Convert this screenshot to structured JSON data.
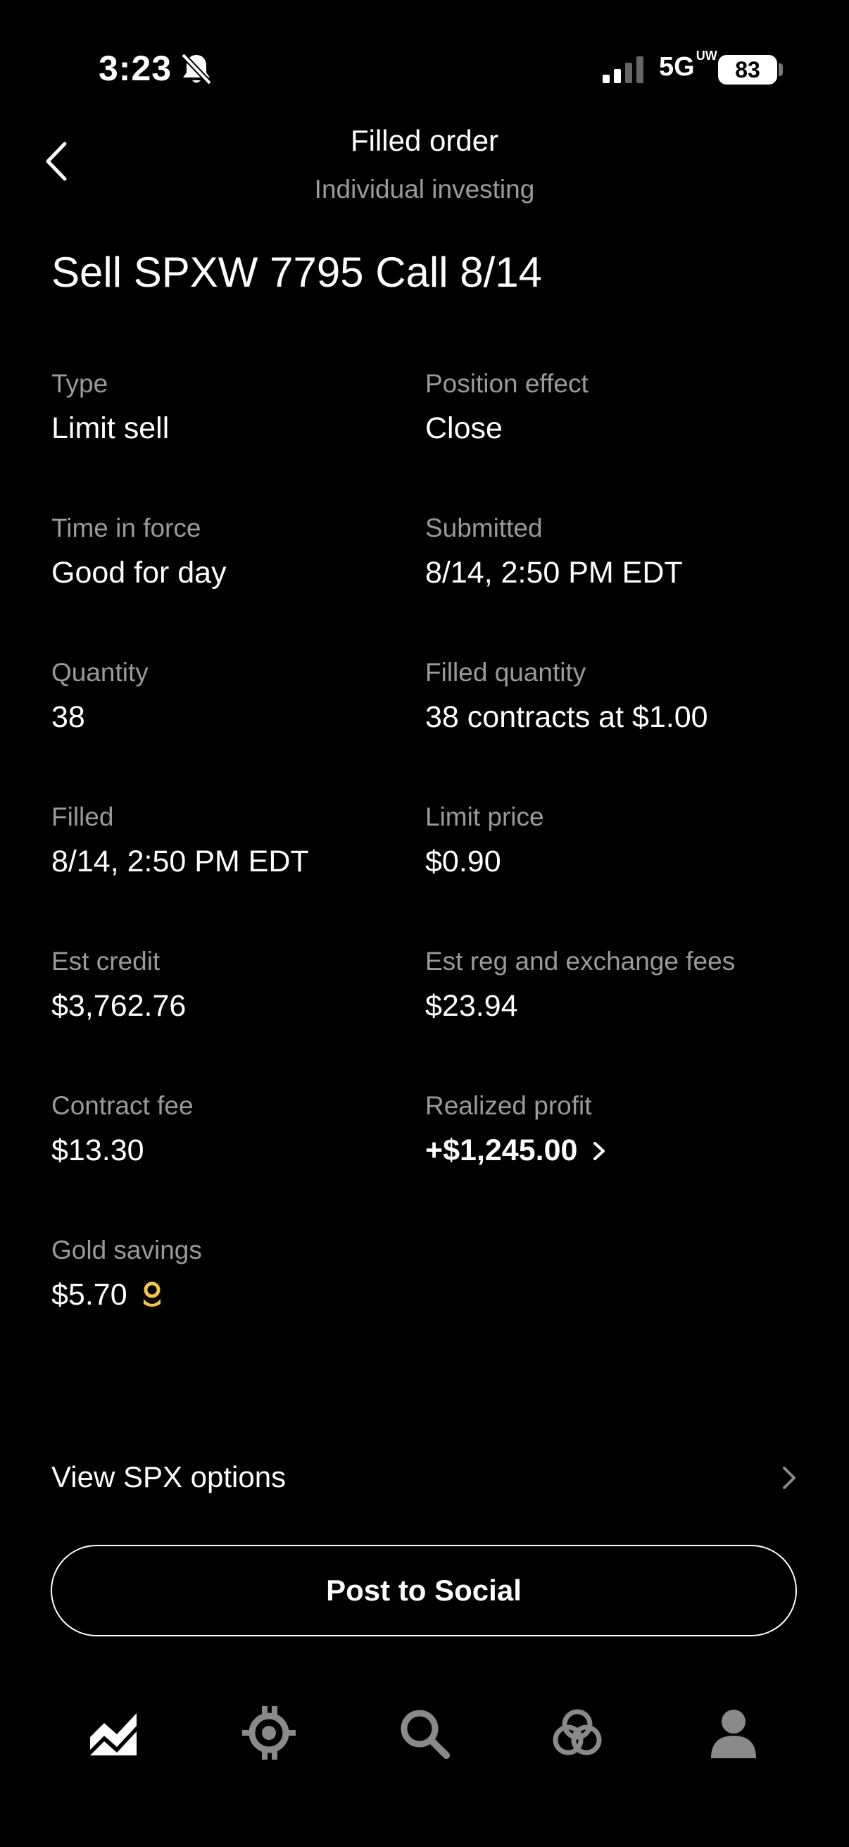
{
  "status_bar": {
    "time": "3:23",
    "network": "5G",
    "network_superscript": "UW",
    "battery": "83"
  },
  "header": {
    "title": "Filled order",
    "subtitle": "Individual investing"
  },
  "order": {
    "title": "Sell SPXW 7795 Call 8/14"
  },
  "fields": {
    "type": {
      "label": "Type",
      "value": "Limit sell"
    },
    "position_effect": {
      "label": "Position effect",
      "value": "Close"
    },
    "time_in_force": {
      "label": "Time in force",
      "value": "Good for day"
    },
    "submitted": {
      "label": "Submitted",
      "value": "8/14, 2:50 PM EDT"
    },
    "quantity": {
      "label": "Quantity",
      "value": "38"
    },
    "filled_quantity": {
      "label": "Filled quantity",
      "value": "38 contracts at $1.00"
    },
    "filled": {
      "label": "Filled",
      "value": "8/14, 2:50 PM EDT"
    },
    "limit_price": {
      "label": "Limit price",
      "value": "$0.90"
    },
    "est_credit": {
      "label": "Est credit",
      "value": "$3,762.76"
    },
    "est_fees": {
      "label": "Est reg and exchange fees",
      "value": "$23.94"
    },
    "contract_fee": {
      "label": "Contract fee",
      "value": "$13.30"
    },
    "realized_profit": {
      "label": "Realized profit",
      "value": "+$1,245.00"
    },
    "gold_savings": {
      "label": "Gold savings",
      "value": "$5.70"
    }
  },
  "actions": {
    "view_options": "View SPX options",
    "post_to_social": "Post to Social"
  },
  "colors": {
    "background": "#000000",
    "label_gray": "#9a9a9a",
    "gold": "#f5c542"
  },
  "icons": {
    "back": "chevron-left-icon",
    "bell": "bell-slash-icon",
    "tabs": [
      "investing-chart-icon",
      "crypto-icon",
      "search-icon",
      "strategies-icon",
      "account-person-icon"
    ]
  }
}
